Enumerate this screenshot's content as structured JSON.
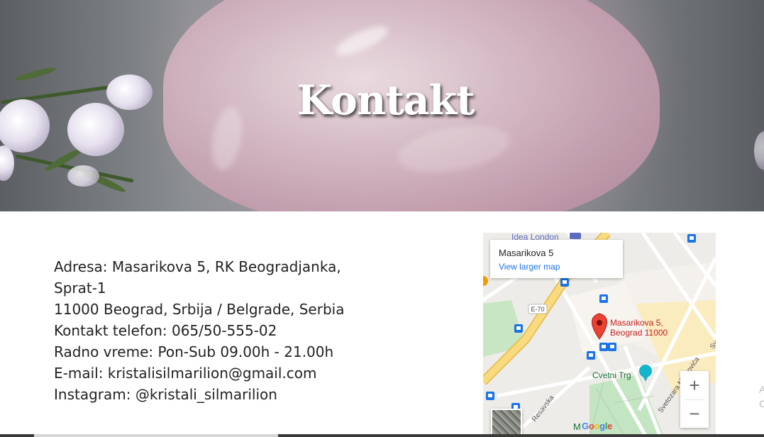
{
  "hero": {
    "title": "Kontakt"
  },
  "contact": {
    "lines": [
      "Adresa: Masarikova 5, RK Beogradjanka,",
      "Sprat-1",
      "11000 Beograd, Srbija / Belgrade, Serbia",
      "Kontakt telefon: 065/50-555-02",
      "Radno vreme: Pon-Sub 09.00h - 21.00h",
      "E-mail: kristalisilmarilion@gmail.com",
      "Instagram: @kristali_silmarilion"
    ]
  },
  "map": {
    "place_name": "Masarikova 5",
    "larger_map_link": "View larger map",
    "marker_label_line1": "Masarikova 5,",
    "marker_label_line2": "Beograd 11000",
    "poi_top": "Idea London",
    "poi_cvetni_trg": "Cvetni Trg",
    "road_badge": "E-70",
    "street_resavska": "Resavska",
    "street_svetozara": "Svetozara Markovića",
    "street_partial": "Sv",
    "park_label": "M",
    "google_logo": [
      "G",
      "o",
      "o",
      "g",
      "l",
      "e"
    ],
    "zoom_in": "+",
    "zoom_out": "−",
    "colors": {
      "marker": "#ea4335",
      "link": "#1a73e8",
      "road_major": "#f7d87c",
      "park": "#c3e5c1",
      "transit": "#1a73e8"
    }
  },
  "edge_text": [
    "A",
    "C"
  ],
  "icons": [
    "map-marker-icon",
    "bus-stop-icon",
    "shopping-cart-icon",
    "tram-icon",
    "layers-icon"
  ]
}
